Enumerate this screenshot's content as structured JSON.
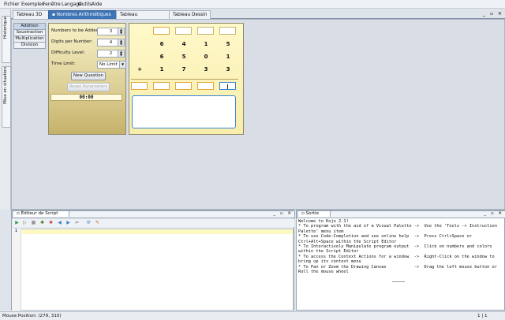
{
  "menu": [
    "Fichier",
    "Exemples",
    "Fenêtre",
    "Langage",
    "Outils",
    "Aide"
  ],
  "sidebar_tabs": [
    {
      "label": "Historique"
    },
    {
      "label": "Mise en situation"
    }
  ],
  "tabs": [
    {
      "label": "Tableau 3D"
    },
    {
      "label": "Nombres Arithmétiques"
    },
    {
      "label": "Tableau Mathématique"
    },
    {
      "label": "Tableau Dessin"
    }
  ],
  "window_controls": "_ ▫ ✕",
  "operations": [
    "Addition",
    "Soustraction",
    "Multiplication",
    "Division"
  ],
  "controls": {
    "numbers_label": "Numbers to be Added:",
    "numbers_value": "3",
    "digits_label": "Digits per Number:",
    "digits_value": "4",
    "difficulty_label": "Difficulty Level:",
    "difficulty_value": "2",
    "time_label": "Time Limit:",
    "time_value": "No Limit",
    "new_question": "New Question",
    "reset_parameters": "Reset Parameters",
    "timer": "00:00"
  },
  "problem": {
    "rows": [
      [
        "6",
        "4",
        "1",
        "5"
      ],
      [
        "6",
        "5",
        "0",
        "1"
      ],
      [
        "1",
        "7",
        "3",
        "3"
      ]
    ],
    "operator": "+"
  },
  "script_panel": {
    "title": "Éditeur de Script",
    "line_number": "1"
  },
  "output_panel": {
    "title": "Sortie",
    "text": "Welcome to Kojo 2.1!\n* To program with the aid of a Visual Palette ->  Use the 'Tools -> Instruction\nPalette' menu item\n* To use Code-Completion and see online help  ->  Press Ctrl+Space or\nCtrl+Alt+Space within the Script Editor\n* To Interactively Manipulate program output  ->  Click on numbers and colors\nwithin the Script Editor\n* To access the Context Actions for a window  ->  Right-Click on the window to\nbring up its context menu\n* To Pan or Zoom the Drawing Canvas           ->  Drag the left mouse button or\nRoll the mouse wheel"
  },
  "status": {
    "mouse_position": "Mouse Position: (279, 310)",
    "cursor": "1 | 1"
  },
  "colors": {
    "accent": "#3d74b6",
    "panel_gold": "#ded199",
    "board_yellow": "#fff8c9",
    "focus_blue": "#3a86d6"
  }
}
